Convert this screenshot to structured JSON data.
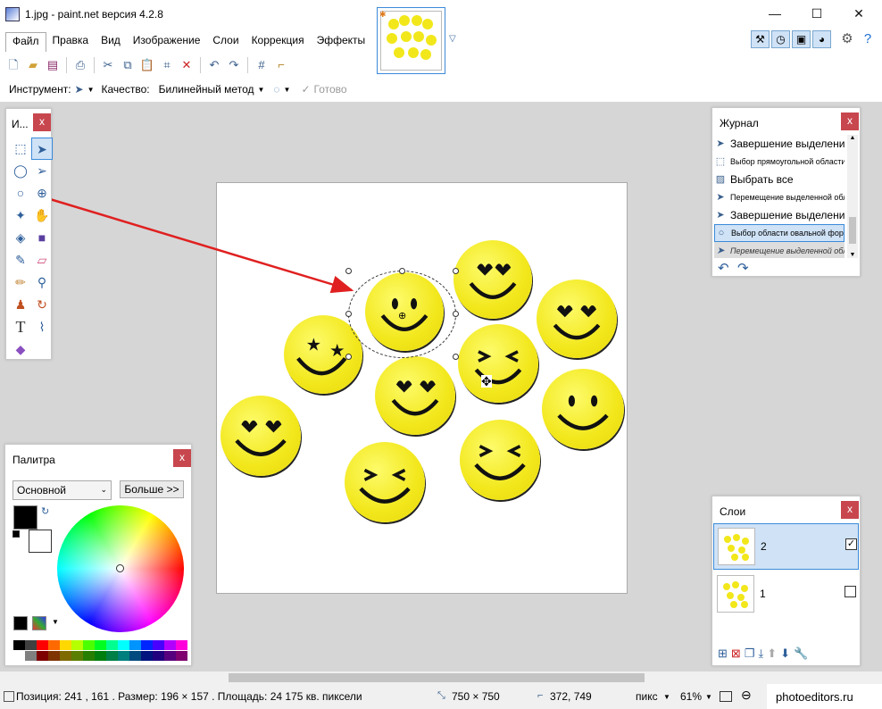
{
  "window": {
    "title": "1.jpg - paint.net версия 4.2.8",
    "minimize": "—",
    "maximize": "☐",
    "close": "✕"
  },
  "menu": [
    "Файл",
    "Правка",
    "Вид",
    "Изображение",
    "Слои",
    "Коррекция",
    "Эффекты"
  ],
  "toolbar2": {
    "tool_label": "Инструмент:",
    "quality_label": "Качество:",
    "quality_value": "Билинейный метод",
    "done_label": "Готово"
  },
  "tools_panel": {
    "title": "И...",
    "close": "x"
  },
  "history_panel": {
    "title": "Журнал",
    "close": "x",
    "items": [
      {
        "label": "Завершение выделения",
        "size": "big",
        "state": "normal"
      },
      {
        "label": "Выбор прямоугольной области",
        "size": "small",
        "state": "normal"
      },
      {
        "label": "Выбрать все",
        "size": "big",
        "state": "normal"
      },
      {
        "label": "Перемещение выделенной области",
        "size": "small",
        "state": "normal"
      },
      {
        "label": "Завершение выделения",
        "size": "big",
        "state": "normal"
      },
      {
        "label": "Выбор области овальной формы",
        "size": "small",
        "state": "selected"
      },
      {
        "label": "Перемещение выделенной области",
        "size": "small",
        "state": "future"
      }
    ]
  },
  "palette_panel": {
    "title": "Палитра",
    "close": "x",
    "palette_select": "Основной",
    "more_button": "Больше >>",
    "primary_color": "#000000",
    "secondary_color": "#ffffff"
  },
  "layers_panel": {
    "title": "Слои",
    "close": "x",
    "layers": [
      {
        "name": "2",
        "visible": true,
        "selected": true
      },
      {
        "name": "1",
        "visible": false,
        "selected": false
      }
    ]
  },
  "statusbar": {
    "position": "Позиция: 241 , 161 . Размер: 196  ×  157 . Площадь: 24 175 кв. пиксели",
    "image_size": "750 × 750",
    "cursor": "372, 749",
    "unit": "пикс",
    "zoom": "61%",
    "watermark": "photoeditors.ru"
  },
  "colors": {
    "accent": "#3b8ad9",
    "workspace": "#d6d6d6",
    "close_red": "#c8464e",
    "smiley_yellow": "#f2e71a",
    "arrow_red": "#e02020"
  }
}
